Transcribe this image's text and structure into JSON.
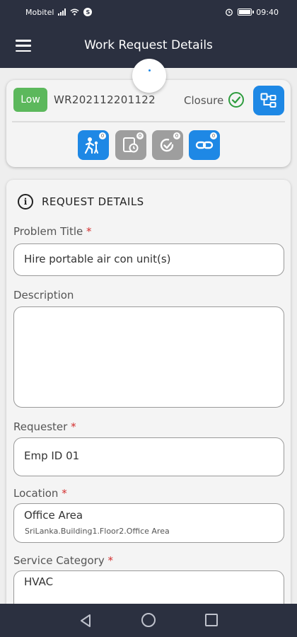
{
  "status_bar": {
    "carrier": "Mobitel",
    "badge": "S",
    "time": "09:40"
  },
  "app_bar": {
    "title": "Work Request Details",
    "menu_icon": "hamburger-menu-icon"
  },
  "summary": {
    "priority": "Low",
    "priority_color": "#5cb85c",
    "request_number": "WR202112201122",
    "status": "Closure",
    "status_color": "#2e9c3e",
    "accent_color": "#1e88e5",
    "workflow_icon": "workflow-icon",
    "actions": [
      {
        "icon": "assignee-icon",
        "badge": "0",
        "color": "#1e88e5"
      },
      {
        "icon": "schedule-icon",
        "badge": "0",
        "color": "#9e9e9e"
      },
      {
        "icon": "sign-off-icon",
        "badge": "0",
        "color": "#9e9e9e"
      },
      {
        "icon": "link-icon",
        "badge": "0",
        "color": "#1e88e5"
      }
    ]
  },
  "details": {
    "section_title": "REQUEST DETAILS",
    "required_mark": "*",
    "problem_title": {
      "label": "Problem Title",
      "value": "Hire portable air con unit(s)"
    },
    "description": {
      "label": "Description",
      "value": ""
    },
    "requester": {
      "label": "Requester",
      "value": "Emp ID 01"
    },
    "location": {
      "label": "Location",
      "value": "Office Area",
      "path": "SriLanka.Building1.Floor2.Office Area"
    },
    "service_category": {
      "label": "Service Category",
      "value": "HVAC"
    }
  }
}
